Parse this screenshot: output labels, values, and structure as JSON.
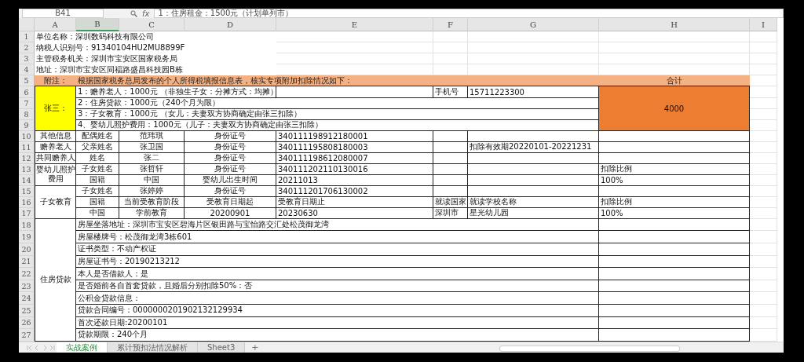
{
  "formula_bar": {
    "name_box": "B41",
    "fx": "fx",
    "formula": "1：住房租金：1500元（计划单列市）"
  },
  "columns": [
    {
      "label": "A",
      "selected": false
    },
    {
      "label": "B",
      "selected": true
    },
    {
      "label": "C",
      "selected": false
    },
    {
      "label": "D",
      "selected": false
    },
    {
      "label": "E",
      "selected": false
    },
    {
      "label": "F",
      "selected": false
    },
    {
      "label": "G",
      "selected": false
    },
    {
      "label": "H",
      "selected": false
    },
    {
      "label": "I",
      "selected": false
    }
  ],
  "row_numbers": [
    "1",
    "2",
    "3",
    "4",
    "5",
    "6",
    "7",
    "8",
    "9",
    "10",
    "11",
    "12",
    "13",
    "14",
    "15",
    "16",
    "17",
    "18",
    "19",
    "20",
    "21",
    "22",
    "23",
    "24",
    "25",
    "26",
    "27"
  ],
  "cells": [
    {
      "text": "单位名称：深圳数码科技有限公司",
      "kind": "plain"
    },
    {
      "text": "纳税人识别号：91340104HU2MU8899F",
      "kind": "plain"
    },
    {
      "text": "主管税务机关：深圳市宝安区国家税务局",
      "kind": "plain"
    },
    {
      "text": "地址：深圳市宝安区同福路盛昌科技园B栋",
      "kind": "plain"
    },
    {
      "text": "附注：",
      "kind": "note"
    },
    {
      "text": "根据国家税务总局发布的个人所得税填报信息表，核实专项附加扣除情况如下：",
      "kind": "note"
    },
    {
      "text": "合计",
      "kind": "note"
    },
    {
      "text": "张三：",
      "kind": "name"
    },
    {
      "text": "1：赡养老人：1000元 （非独生子女：分摊方式：均摊）",
      "kind": "plain"
    },
    {
      "text": "手机号",
      "kind": "plain"
    },
    {
      "text": "15711223300",
      "kind": "plain"
    },
    {
      "text": "4000",
      "kind": "total"
    },
    {
      "text": "2：住房贷款：1000元（240个月为限）",
      "kind": "plain"
    },
    {
      "text": "3：子女教育：1000元 （女儿：夫妻双方协商确定由张三扣除）",
      "kind": "plain"
    },
    {
      "text": "4、婴幼儿照护费用：1000元（儿子：夫妻双方协商确定由张三扣除）",
      "kind": "plain"
    },
    {
      "text": "其他信息",
      "kind": "plain"
    },
    {
      "text": "配偶姓名",
      "kind": "plain"
    },
    {
      "text": "范玮琪",
      "kind": "plain"
    },
    {
      "text": "身份证号",
      "kind": "plain"
    },
    {
      "text": "340111198912180001",
      "kind": "plain"
    },
    {
      "text": "赡养老人",
      "kind": "plain"
    },
    {
      "text": "父亲姓名",
      "kind": "plain"
    },
    {
      "text": "张卫国",
      "kind": "plain"
    },
    {
      "text": "身份证号",
      "kind": "plain"
    },
    {
      "text": "340111195808180003",
      "kind": "plain"
    },
    {
      "text": "扣除有效期20220101-20221231",
      "kind": "plain"
    },
    {
      "text": "共同赡养人",
      "kind": "plain"
    },
    {
      "text": "姓名",
      "kind": "plain"
    },
    {
      "text": "张二",
      "kind": "plain"
    },
    {
      "text": "身份证号",
      "kind": "plain"
    },
    {
      "text": "340111198612080007",
      "kind": "plain"
    },
    {
      "text": "婴幼儿照护费用",
      "kind": "plain"
    },
    {
      "text": "子女姓名",
      "kind": "plain"
    },
    {
      "text": "张哲轩",
      "kind": "plain"
    },
    {
      "text": "身份证号",
      "kind": "plain"
    },
    {
      "text": "340111202110130016",
      "kind": "plain"
    },
    {
      "text": "扣除比例",
      "kind": "plain"
    },
    {
      "text": "国籍",
      "kind": "plain"
    },
    {
      "text": "中国",
      "kind": "plain"
    },
    {
      "text": "婴幼儿出生时间",
      "kind": "plain"
    },
    {
      "text": "20211013",
      "kind": "plain"
    },
    {
      "text": "100%",
      "kind": "plain"
    },
    {
      "text": "子女教育",
      "kind": "plain"
    },
    {
      "text": "子女姓名",
      "kind": "plain"
    },
    {
      "text": "张婷婷",
      "kind": "plain"
    },
    {
      "text": "身份证号",
      "kind": "plain"
    },
    {
      "text": "340111201706130002",
      "kind": "plain"
    },
    {
      "text": "国籍",
      "kind": "plain"
    },
    {
      "text": "当前受教育阶段",
      "kind": "plain"
    },
    {
      "text": "受教育日期起",
      "kind": "plain"
    },
    {
      "text": "受教育日期止",
      "kind": "plain"
    },
    {
      "text": "就读国家",
      "kind": "plain"
    },
    {
      "text": "就读学校名称",
      "kind": "plain"
    },
    {
      "text": "扣除比例",
      "kind": "plain"
    },
    {
      "text": "中国",
      "kind": "plain"
    },
    {
      "text": "学前教育",
      "kind": "plain"
    },
    {
      "text": "20200901",
      "kind": "plain"
    },
    {
      "text": "20230630",
      "kind": "plain"
    },
    {
      "text": "深圳市",
      "kind": "plain"
    },
    {
      "text": "星光幼儿园",
      "kind": "plain"
    },
    {
      "text": "100%",
      "kind": "plain"
    },
    {
      "text": "住房贷款",
      "kind": "plain"
    },
    {
      "text": "房屋坐落地址：深圳市宝安区碧海片区银田路与宝怡路交汇处松茂御龙湾",
      "kind": "plain"
    },
    {
      "text": "房屋楼牌号：松茂御龙湾3栋601",
      "kind": "plain"
    },
    {
      "text": "证书类型：不动产权证",
      "kind": "plain"
    },
    {
      "text": "房屋证书号：20190213212",
      "kind": "plain"
    },
    {
      "text": "本人是否借款人：是",
      "kind": "plain"
    },
    {
      "text": "是否婚前各自首套贷款，且婚后分别扣除50%：否",
      "kind": "plain"
    },
    {
      "text": "公积金贷款信息：",
      "kind": "plain"
    },
    {
      "text": "贷款合同编号：0000000201902132129934",
      "kind": "plain"
    },
    {
      "text": "首次还款日期:20200101",
      "kind": "plain"
    },
    {
      "text": "贷款期限：240个月",
      "kind": "plain"
    }
  ],
  "sheet_tabs": [
    {
      "label": "实战案例",
      "selected": true
    },
    {
      "label": "累计预扣法情况解析",
      "selected": false
    },
    {
      "label": "Sheet3",
      "selected": false
    }
  ],
  "add_sheet": "+"
}
